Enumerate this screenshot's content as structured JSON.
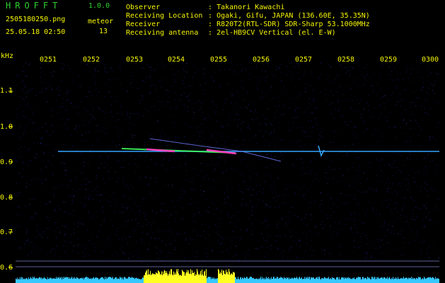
{
  "header": {
    "app_title": "HROFFT",
    "app_version": "1.0.0",
    "file_name": "2505180250.png",
    "timestamp": "25.05.18 02:50",
    "class_label": "meteor",
    "class_count": "13"
  },
  "station": {
    "rows": [
      {
        "key": "Observer",
        "sep": ":",
        "value": "Takanori Kawachi"
      },
      {
        "key": "Receiving Location",
        "sep": ":",
        "value": "Ogaki, Gifu, JAPAN (136.60E, 35.35N)"
      },
      {
        "key": "Receiver",
        "sep": ":",
        "value": "R820T2(RTL-SDR) SDR-Sharp 53.1000MHz"
      },
      {
        "key": "Receiving antenna",
        "sep": ":",
        "value": "2el-HB9CV Vertical (el. E-W)"
      }
    ]
  },
  "axis": {
    "y_unit": "kHz",
    "y_ticks": [
      "1.1",
      "1.0",
      "0.9",
      "0.8",
      "0.7",
      "0.6"
    ],
    "x_ticks": [
      "0251",
      "0252",
      "0253",
      "0254",
      "0255",
      "0256",
      "0257",
      "0258",
      "0259",
      "0300"
    ]
  },
  "colors": {
    "background": "#000000",
    "noise": "#1a1f8a",
    "carrier": "#33a6ff",
    "echo_hot": "#ff40c0",
    "echo_warm": "#40ff60",
    "level_bar": "#35c8ff",
    "level_peak": "#ffff20",
    "label_yellow": "#f5f500",
    "label_green": "#2fd12f"
  }
}
